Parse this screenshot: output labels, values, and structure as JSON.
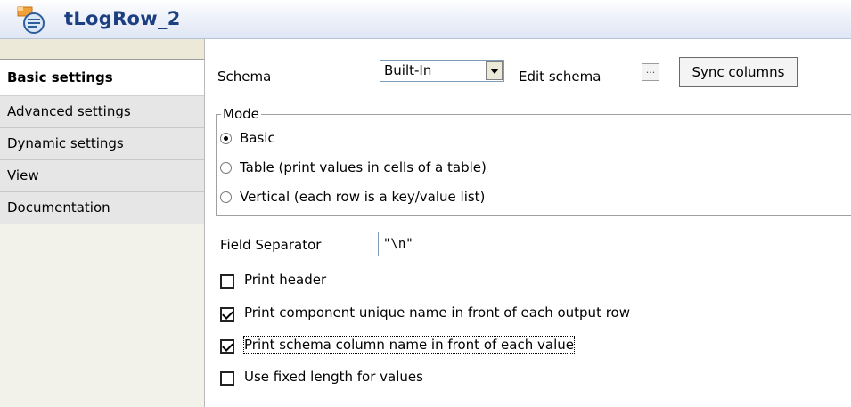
{
  "header": {
    "title": "tLogRow_2",
    "icon": "log-row-component-icon"
  },
  "sidebar": {
    "tabs": [
      {
        "label": "Basic settings",
        "active": true
      },
      {
        "label": "Advanced settings",
        "active": false
      },
      {
        "label": "Dynamic settings",
        "active": false
      },
      {
        "label": "View",
        "active": false
      },
      {
        "label": "Documentation",
        "active": false
      }
    ]
  },
  "basic": {
    "schema_label": "Schema",
    "schema_value": "Built-In",
    "edit_schema_label": "Edit schema",
    "edit_schema_button": "...",
    "sync_columns": "Sync columns",
    "mode": {
      "title": "Mode",
      "options": [
        {
          "label": "Basic",
          "selected": true
        },
        {
          "label": "Table (print values in cells of a table)",
          "selected": false
        },
        {
          "label": "Vertical (each row is a key/value list)",
          "selected": false
        }
      ]
    },
    "field_separator_label": "Field Separator",
    "field_separator_value": "\"\\n\"",
    "checkboxes": [
      {
        "label": "Print header",
        "checked": false
      },
      {
        "label": "Print component unique name in front of each output row",
        "checked": true
      },
      {
        "label": "Print schema column name in front of each value",
        "checked": true
      },
      {
        "label": "Use fixed length for values",
        "checked": false
      }
    ]
  },
  "colors": {
    "title": "#1c3f82",
    "sidebar_bg": "#f2f1ea",
    "border": "#a0a0a0"
  }
}
